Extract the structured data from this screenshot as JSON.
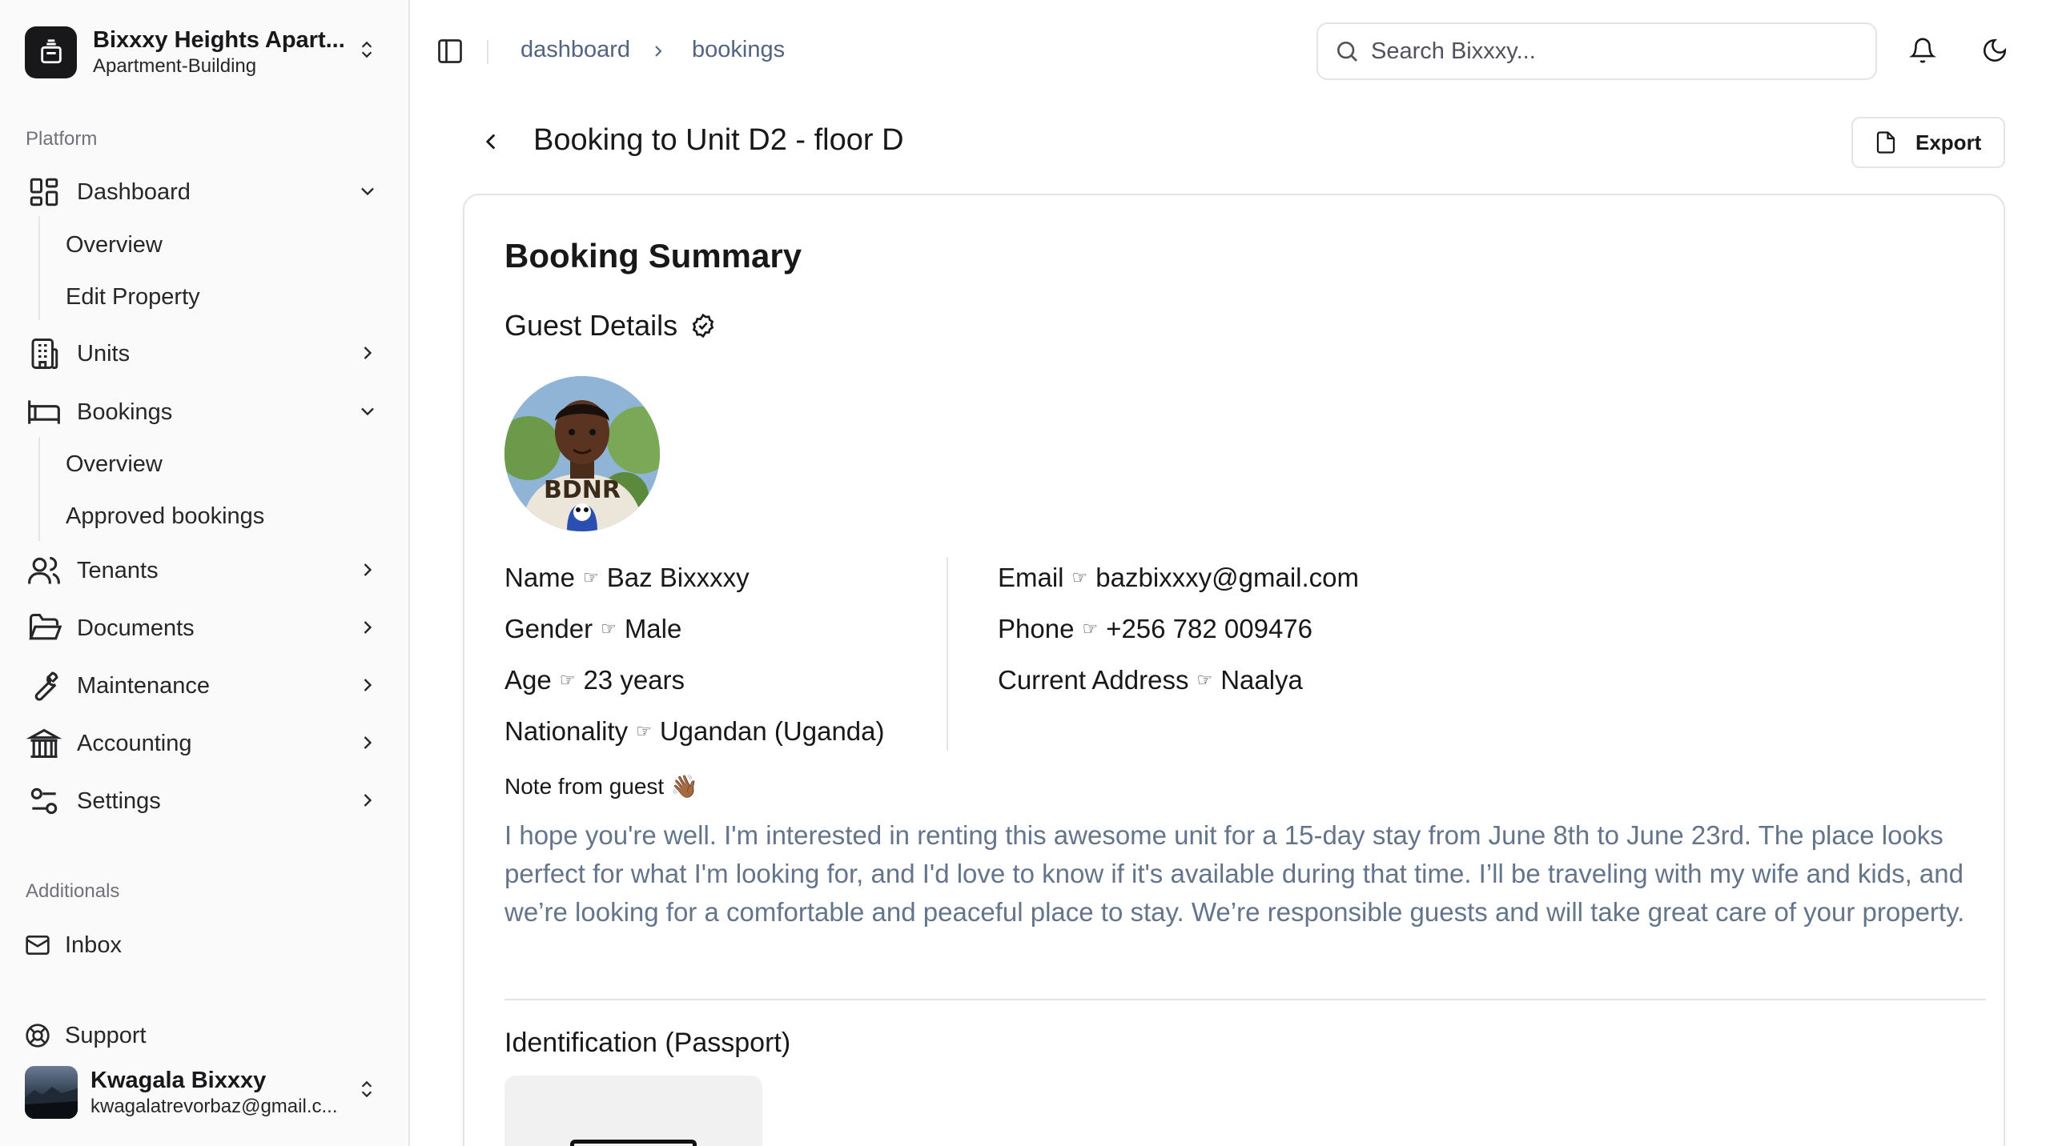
{
  "org": {
    "name": "Bixxxy Heights Apart...",
    "type": "Apartment-Building"
  },
  "sidebar": {
    "platform_label": "Platform",
    "dashboard": {
      "label": "Dashboard",
      "sub": [
        "Overview",
        "Edit Property"
      ]
    },
    "units": {
      "label": "Units"
    },
    "bookings": {
      "label": "Bookings",
      "sub": [
        "Overview",
        "Approved bookings"
      ]
    },
    "tenants": {
      "label": "Tenants"
    },
    "documents": {
      "label": "Documents"
    },
    "maintenance": {
      "label": "Maintenance"
    },
    "accounting": {
      "label": "Accounting"
    },
    "settings": {
      "label": "Settings"
    },
    "additionals_label": "Additionals",
    "inbox": {
      "label": "Inbox"
    },
    "support": {
      "label": "Support"
    }
  },
  "user": {
    "name": "Kwagala Bixxxy",
    "email": "kwagalatrevorbaz@gmail.c..."
  },
  "header": {
    "breadcrumb": [
      "dashboard",
      "bookings"
    ],
    "search_placeholder": "Search Bixxxy..."
  },
  "page": {
    "title": "Booking to Unit D2 - floor D",
    "export_label": "Export"
  },
  "summary": {
    "title": "Booking Summary",
    "guest_title": "Guest Details",
    "hand": "☞",
    "left": [
      {
        "label": "Name",
        "value": "Baz Bixxxxy"
      },
      {
        "label": "Gender",
        "value": "Male"
      },
      {
        "label": "Age",
        "value": "23 years"
      },
      {
        "label": "Nationality",
        "value": "Ugandan (Uganda)"
      }
    ],
    "right": [
      {
        "label": "Email",
        "value": "bazbixxxy@gmail.com"
      },
      {
        "label": "Phone",
        "value": "+256 782 009476"
      },
      {
        "label": "Current Address",
        "value": "Naalya"
      }
    ],
    "note_label": "Note from guest 👋🏾",
    "note": "I hope you're well. I'm interested in renting this awesome unit for a 15-day stay from June 8th to June 23rd. The place looks perfect for what I'm looking for, and I'd love to know if it's available during that time. I’ll be traveling with my wife and kids, and we’re looking for a comfortable and peaceful place to stay. We’re responsible guests and will take great care of your property.",
    "id_title": "Identification (Passport)",
    "avatar_shirt_text": "BDNR"
  }
}
